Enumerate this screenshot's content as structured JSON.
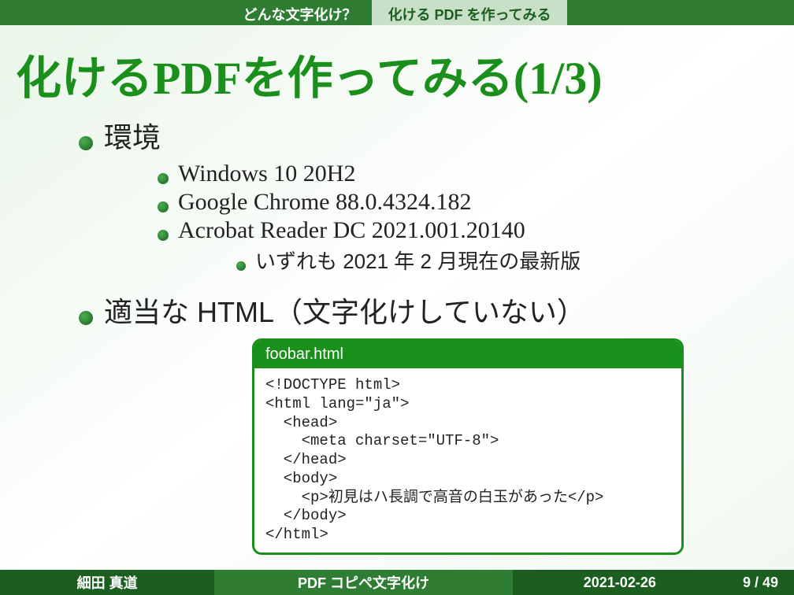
{
  "breadcrumb": {
    "section": "どんな文字化け？",
    "subsection": "化ける PDF を作ってみる"
  },
  "title": "化けるPDFを作ってみる(1/3)",
  "items": [
    {
      "level": 1,
      "text": "環境"
    },
    {
      "level": 2,
      "text": "Windows 10 20H2"
    },
    {
      "level": 2,
      "text": "Google Chrome 88.0.4324.182"
    },
    {
      "level": 2,
      "text": "Acrobat Reader DC 2021.001.20140"
    },
    {
      "level": 3,
      "text": "いずれも 2021 年 2 月現在の最新版"
    },
    {
      "level": 1,
      "text": "適当な HTML（文字化けしていない）"
    }
  ],
  "code": {
    "filename": "foobar.html",
    "content": "<!DOCTYPE html>\n<html lang=\"ja\">\n  <head>\n    <meta charset=\"UTF-8\">\n  </head>\n  <body>\n    <p>初見はハ長調で高音の白玉があった</p>\n  </body>\n</html>"
  },
  "footer": {
    "author": "細田 真道",
    "presentation": "PDF コピペ文字化け",
    "date": "2021-02-26",
    "page_current": "9",
    "page_total": "49"
  }
}
